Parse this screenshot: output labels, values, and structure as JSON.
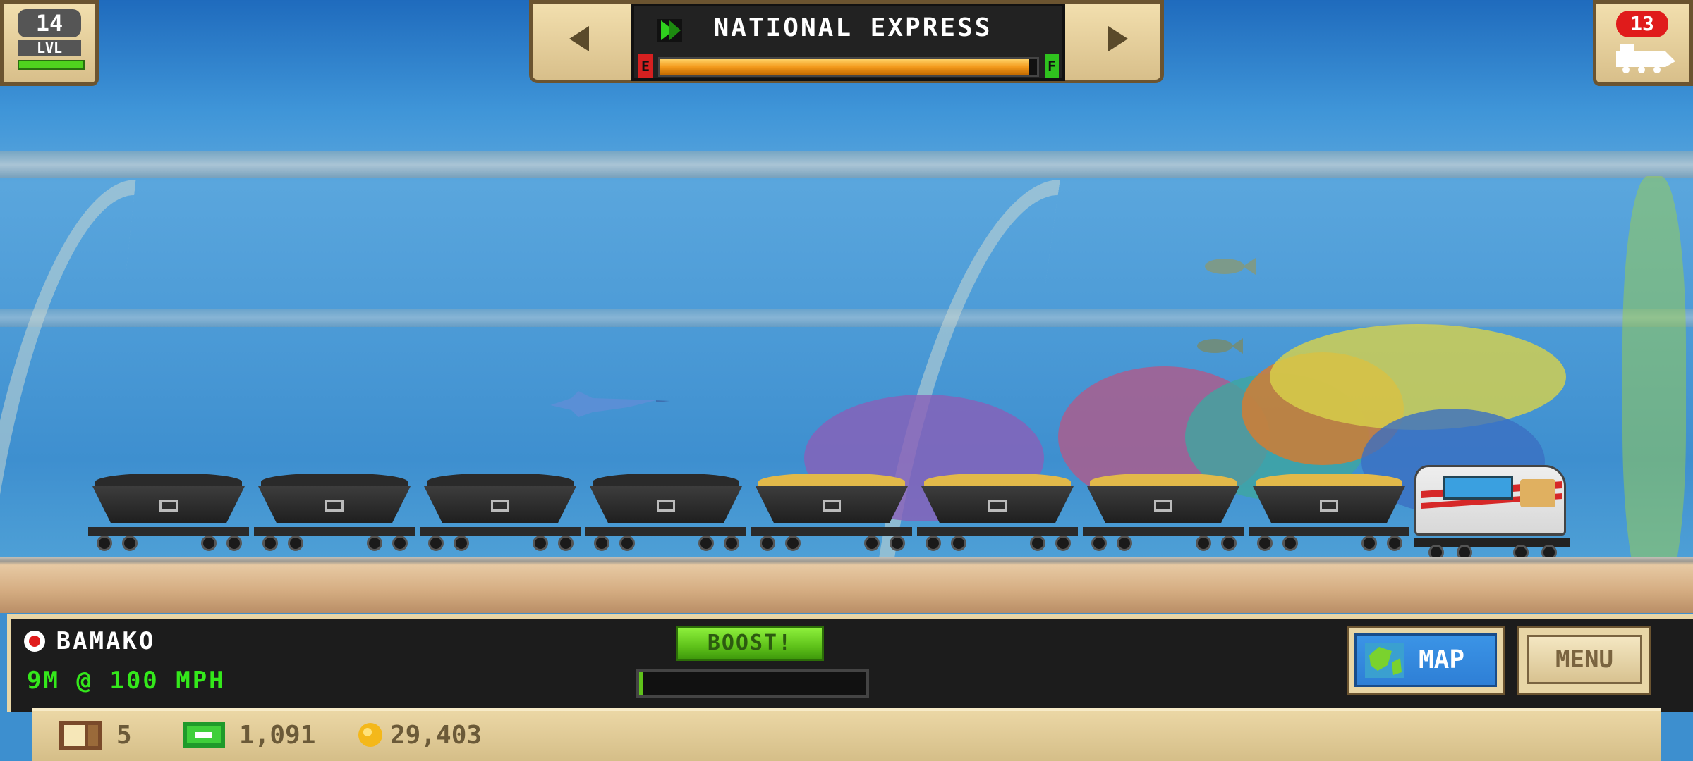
{
  "hud": {
    "level_value": "14",
    "level_label": "LVL",
    "route_name": "NATIONAL EXPRESS",
    "fuel_empty_label": "E",
    "fuel_full_label": "F",
    "fuel_level": 0.98,
    "train_count": "13"
  },
  "station": {
    "destination": "BAMAKO",
    "distance_speed": "9M @ 100 MPH",
    "boost_label": "BOOST!",
    "boost_progress": 0.02
  },
  "buttons": {
    "map_label": "MAP",
    "menu_label": "MENU"
  },
  "resources": {
    "crates": "5",
    "cash": "1,091",
    "coins": "29,403"
  },
  "train": {
    "cars": [
      "coal",
      "coal",
      "coal",
      "coal",
      "grain",
      "grain",
      "grain",
      "grain"
    ]
  },
  "colors": {
    "fuel_bar": "#f39a1c",
    "boost_green": "#5fc21a",
    "hud_green": "#34e81b",
    "badge_red": "#e01b1b",
    "map_blue": "#2e7fd6"
  }
}
